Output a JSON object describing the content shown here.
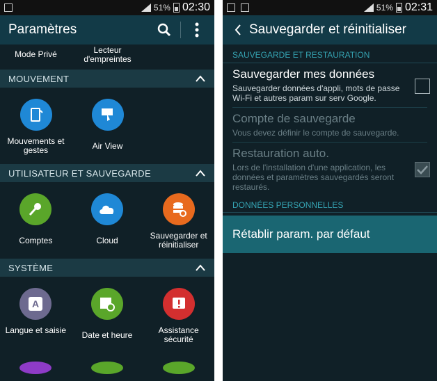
{
  "left": {
    "status": {
      "battery": "51%",
      "time": "02:30"
    },
    "actionbar": {
      "title": "Paramètres"
    },
    "top_items": [
      "Mode Privé",
      "Lecteur d'empreintes"
    ],
    "sections": [
      {
        "header": "MOUVEMENT",
        "items": [
          {
            "label": "Mouvements et gestes",
            "color": "#1f88d6"
          },
          {
            "label": "Air View",
            "color": "#1f88d6"
          }
        ]
      },
      {
        "header": "UTILISATEUR ET SAUVEGARDE",
        "items": [
          {
            "label": "Comptes",
            "color": "#5aa62a"
          },
          {
            "label": "Cloud",
            "color": "#1f88d6"
          },
          {
            "label": "Sauvegarder et réinitialiser",
            "color": "#e86a1e"
          }
        ]
      },
      {
        "header": "SYSTÈME",
        "items": [
          {
            "label": "Langue et saisie",
            "color": "#6d6a8f"
          },
          {
            "label": "Date et heure",
            "color": "#5aa62a"
          },
          {
            "label": "Assistance sécurité",
            "color": "#d32f2f"
          }
        ]
      }
    ],
    "partial_colors": [
      "#8e3bc7",
      "#5aa62a",
      "#5aa62a"
    ]
  },
  "right": {
    "status": {
      "battery": "51%",
      "time": "02:31"
    },
    "actionbar": {
      "title": "Sauvegarder et réinitialiser"
    },
    "section1": "SAUVEGARDE ET RESTAURATION",
    "items": [
      {
        "title": "Sauvegarder mes données",
        "desc": "Sauvegarder données d'appli, mots de passe Wi-Fi et autres param sur serv Google.",
        "enabled": true,
        "checkbox": "unchecked"
      },
      {
        "title": "Compte de sauvegarde",
        "desc": "Vous devez définir le compte de sauvegarde.",
        "enabled": false
      },
      {
        "title": "Restauration auto.",
        "desc": "Lors de l'installation d'une application, les données et paramètres sauvegardés seront restaurés.",
        "enabled": false,
        "checkbox": "checked"
      }
    ],
    "section2": "DONNÉES PERSONNELLES",
    "reset_label": "Rétablir param. par défaut"
  }
}
